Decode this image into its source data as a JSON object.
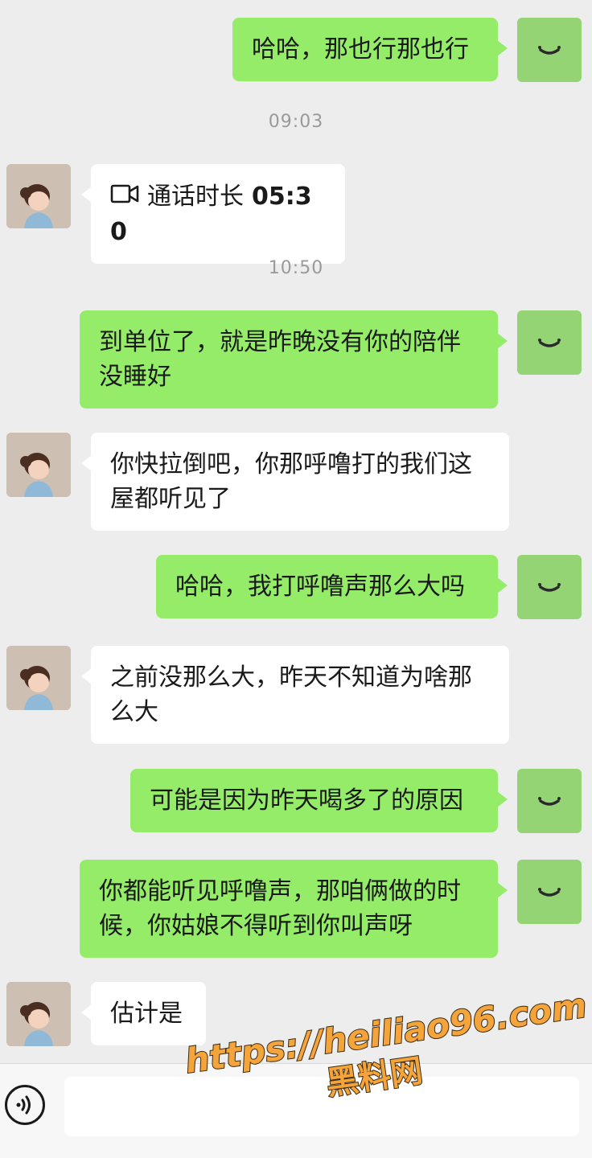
{
  "conversation": [
    {
      "type": "message",
      "side": "me",
      "text": "哈哈，那也行那也行"
    },
    {
      "type": "time",
      "text": "09:03"
    },
    {
      "type": "call",
      "side": "peer",
      "label": "通话时长",
      "duration": "05:30"
    },
    {
      "type": "time",
      "text": "10:50"
    },
    {
      "type": "message",
      "side": "me",
      "text": "到单位了，就是昨晚没有你的陪伴没睡好"
    },
    {
      "type": "message",
      "side": "peer",
      "text": "你快拉倒吧，你那呼噜打的我们这屋都听见了"
    },
    {
      "type": "message",
      "side": "me",
      "text": "哈哈，我打呼噜声那么大吗"
    },
    {
      "type": "message",
      "side": "peer",
      "text": "之前没那么大，昨天不知道为啥那么大"
    },
    {
      "type": "message",
      "side": "me",
      "text": "可能是因为昨天喝多了的原因"
    },
    {
      "type": "message",
      "side": "me",
      "text": "你都能听见呼噜声，那咱俩做的时候，你姑娘不得听到你叫声呀"
    },
    {
      "type": "message",
      "side": "peer",
      "text": "估计是"
    }
  ],
  "input_bar": {
    "voice_icon": "voice-mode-icon",
    "text_value": ""
  },
  "watermark": {
    "url": "https://heiliao96.com",
    "name": "黑料网"
  },
  "colors": {
    "background": "#ededed",
    "my_bubble": "#95ec69",
    "peer_bubble": "#ffffff",
    "timestamp": "#9a9a9a",
    "watermark": "#f4a43a"
  }
}
